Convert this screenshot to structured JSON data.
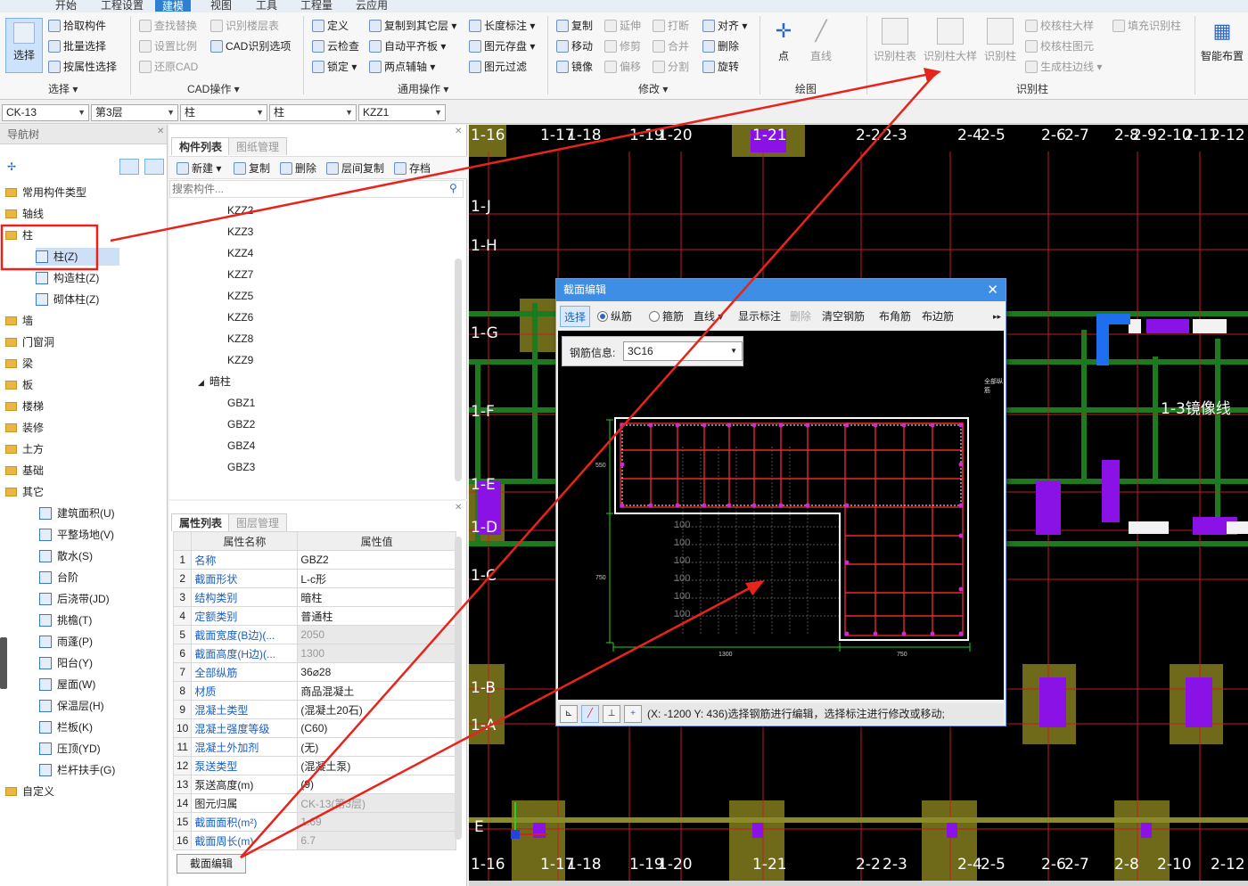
{
  "menu_tabs": [
    "开始",
    "工程设置",
    "建模",
    "视图",
    "工具",
    "工程量",
    "云应用"
  ],
  "active_tab": "建模",
  "ribbon": {
    "select_big": "选择",
    "select_items": [
      "拾取构件",
      "批量选择",
      "按属性选择"
    ],
    "select_group": "选择",
    "cad_items": [
      "查找替换",
      "识别楼层表",
      "设置比例",
      "CAD识别选项",
      "还原CAD"
    ],
    "cad_group": "CAD操作",
    "general_items": [
      "定义",
      "云检查",
      "锁定",
      "复制到其它层",
      "自动平齐板",
      "两点辅轴",
      "长度标注",
      "图元存盘",
      "图元过滤"
    ],
    "general_group": "通用操作",
    "modify_items": [
      "复制",
      "延伸",
      "打断",
      "对齐",
      "移动",
      "修剪",
      "合并",
      "删除",
      "镜像",
      "偏移",
      "分割",
      "旋转"
    ],
    "modify_group": "修改",
    "draw_items": [
      "点",
      "直线"
    ],
    "draw_group": "绘图",
    "recognize_items": [
      "识别柱表",
      "识别柱大样",
      "识别柱",
      "校核柱大样",
      "填充识别柱",
      "校核柱图元",
      "生成柱边线"
    ],
    "recognize_group": "识别柱",
    "smart_layout": "智能布置"
  },
  "selectors": [
    "CK-13",
    "第3层",
    "柱",
    "柱",
    "KZZ1"
  ],
  "nav": {
    "title": "导航树",
    "items": [
      "常用构件类型",
      "轴线",
      "柱",
      "柱(Z)",
      "构造柱(Z)",
      "砌体柱(Z)",
      "墙",
      "门窗洞",
      "梁",
      "板",
      "楼梯",
      "装修",
      "土方",
      "基础",
      "其它",
      "建筑面积(U)",
      "平整场地(V)",
      "散水(S)",
      "台阶",
      "后浇带(JD)",
      "挑檐(T)",
      "雨蓬(P)",
      "阳台(Y)",
      "屋面(W)",
      "保温层(H)",
      "栏板(K)",
      "压顶(YD)",
      "栏杆扶手(G)",
      "自定义"
    ]
  },
  "component_list": {
    "tab_active": "构件列表",
    "tab_other": "图纸管理",
    "toolbar": [
      "新建",
      "复制",
      "删除",
      "层间复制",
      "存档"
    ],
    "search_placeholder": "搜索构件...",
    "items": [
      "KZZ2",
      "KZZ3",
      "KZZ4",
      "KZZ7",
      "KZZ5",
      "KZZ6",
      "KZZ8",
      "KZZ9"
    ],
    "group": "暗柱",
    "group_items": [
      "GBZ1",
      "GBZ2",
      "GBZ4",
      "GBZ3"
    ]
  },
  "properties": {
    "tab_active": "属性列表",
    "tab_other": "图层管理",
    "col_name": "属性名称",
    "col_value": "属性值",
    "rows": [
      {
        "n": "1",
        "k": "名称",
        "v": "GBZ2"
      },
      {
        "n": "2",
        "k": "截面形状",
        "v": "L-c形"
      },
      {
        "n": "3",
        "k": "结构类别",
        "v": "暗柱"
      },
      {
        "n": "4",
        "k": "定额类别",
        "v": "普通柱"
      },
      {
        "n": "5",
        "k": "截面宽度(B边)(...",
        "v": "2050"
      },
      {
        "n": "6",
        "k": "截面高度(H边)(...",
        "v": "1300"
      },
      {
        "n": "7",
        "k": "全部纵筋",
        "v": "36⌀28"
      },
      {
        "n": "8",
        "k": "材质",
        "v": "商品混凝土"
      },
      {
        "n": "9",
        "k": "混凝土类型",
        "v": "(混凝土20石)"
      },
      {
        "n": "10",
        "k": "混凝土强度等级",
        "v": "(C60)"
      },
      {
        "n": "11",
        "k": "混凝土外加剂",
        "v": "(无)"
      },
      {
        "n": "12",
        "k": "泵送类型",
        "v": "(混凝土泵)"
      },
      {
        "n": "13",
        "k": "泵送高度(m)",
        "v": "(9)"
      },
      {
        "n": "14",
        "k": "图元归属",
        "v": "CK-13(第3层)"
      },
      {
        "n": "15",
        "k": "截面面积(m²)",
        "v": "1.69"
      },
      {
        "n": "16",
        "k": "截面周长(m)",
        "v": "6.7"
      }
    ],
    "edit_button": "截面编辑"
  },
  "dialog": {
    "title": "截面编辑",
    "toolbar": [
      "选择",
      "纵筋",
      "箍筋",
      "直线",
      "显示标注",
      "删除",
      "清空钢筋",
      "布角筋",
      "布边筋"
    ],
    "rebar_label": "钢筋信息:",
    "rebar_value": "3C16",
    "dims": {
      "top": "550",
      "left": "750",
      "bottom_left": "1300",
      "bottom_right": "750"
    },
    "grid_label": "100",
    "note": "全部纵筋",
    "status": "(X: -1200 Y: 436)选择钢筋进行编辑，选择标注进行修改或移动;"
  },
  "canvas": {
    "axis_top": [
      "1-16",
      "1-17",
      "1-18",
      "1-19",
      "1-20",
      "1-21",
      "2-2",
      "2-3",
      "2-4",
      "2-5",
      "2-6",
      "2-7",
      "2-8",
      "2-9",
      "2-10",
      "2-11",
      "2-12"
    ],
    "axis_left": [
      "1-J",
      "1-H",
      "1-G",
      "1-F",
      "1-E",
      "1-D",
      "1-C",
      "1-B",
      "1-A",
      "E"
    ],
    "mirror_label": "1-3镜像线"
  }
}
